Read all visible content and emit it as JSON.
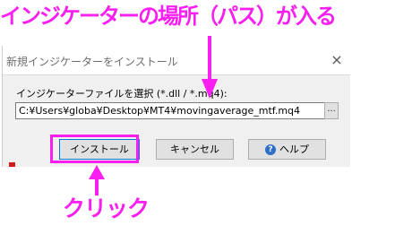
{
  "annotations": {
    "top": "インジケーターの場所（パス）が入る",
    "bottom": "クリック",
    "color": "#f81ff0"
  },
  "dialog": {
    "title": "新規インジケーターをインストール",
    "close_icon": "×",
    "file_label": "インジケーターファイルを選択 (*.dll / *.mq4):",
    "path_value": "C:¥Users¥globa¥Desktop¥MT4¥movingaverage_mtf.mq4",
    "browse_label": "...",
    "buttons": {
      "install": "インストール",
      "cancel": "キャンセル",
      "help": "ヘルプ",
      "help_icon": "?"
    }
  }
}
